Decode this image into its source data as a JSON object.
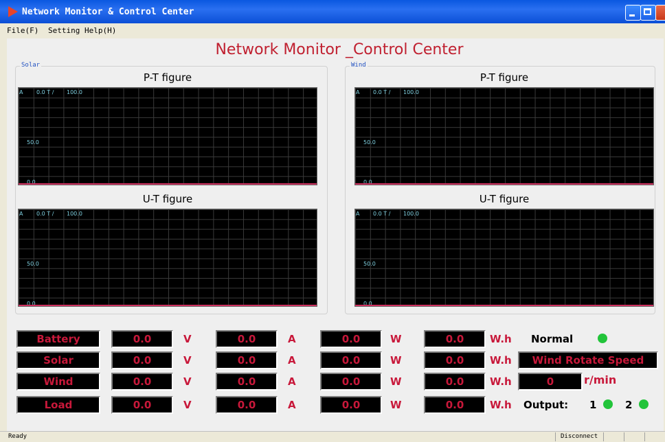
{
  "window": {
    "title": "Network Monitor & Control Center"
  },
  "menu": {
    "file": "File(F)",
    "setting": "Setting",
    "help": "Help(H)"
  },
  "main_title": "Network Monitor _Control Center",
  "solar": {
    "group_label": "Solar",
    "pt_title": "P-T figure",
    "ut_title": "U-T figure"
  },
  "wind": {
    "group_label": "Wind",
    "pt_title": "P-T figure",
    "ut_title": "U-T figure"
  },
  "plot_labels": {
    "axis": "A",
    "time": "0.0 T / ",
    "max": "100.0",
    "mid": "50.0",
    "zero": "0.0"
  },
  "rows": [
    {
      "label": "Battery",
      "v": "0.0",
      "a": "0.0",
      "w": "0.0",
      "wh": "0.0"
    },
    {
      "label": "Solar",
      "v": "0.0",
      "a": "0.0",
      "w": "0.0",
      "wh": "0.0"
    },
    {
      "label": "Wind",
      "v": "0.0",
      "a": "0.0",
      "w": "0.0",
      "wh": "0.0"
    },
    {
      "label": "Load",
      "v": "0.0",
      "a": "0.0",
      "w": "0.0",
      "wh": "0.0"
    }
  ],
  "units": {
    "v": "V",
    "a": "A",
    "w": "W",
    "wh": "W.h"
  },
  "status": {
    "normal": "Normal",
    "wind_speed_label": "Wind Rotate Speed",
    "wind_speed_value": "0",
    "rpm_unit": "r/min",
    "output_label": "Output:",
    "out1": "1",
    "out2": "2"
  },
  "colors": {
    "value_red": "#c8183a",
    "indicator_green": "#22c43a",
    "plot_line": "#d03060"
  },
  "statusbar": {
    "left": "Ready",
    "right": "Disconnect"
  }
}
